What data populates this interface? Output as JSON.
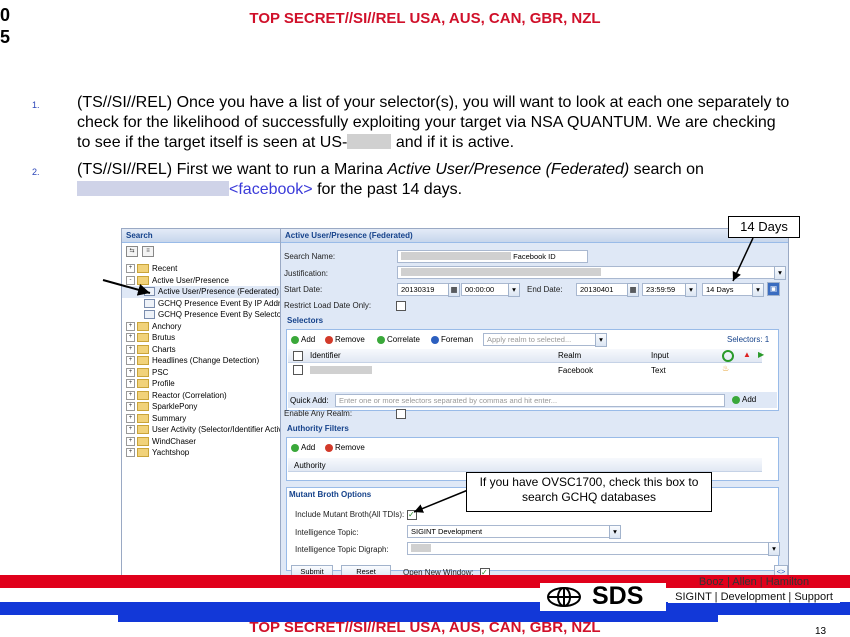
{
  "classification": {
    "top": "TOP SECRET//SI//REL USA, AUS, CAN, GBR, NZL",
    "bottom": "TOP SECRET//SI//REL USA, AUS, CAN, GBR, NZL"
  },
  "cutoff_chars": {
    "a": "0",
    "b": "5"
  },
  "steps": [
    {
      "num": "1.",
      "text": "(TS//SI//REL) Once you have a list of your selector(s), you will want to look at each one separately to check for the likelihood of successfully exploiting your target via NSA QUANTUM. We are checking to see if the target itself is seen at US-",
      "tail": "and if it is active."
    },
    {
      "num": "2.",
      "pre": "(TS//SI//REL) First we want to run a Marina ",
      "italic": "Active User/Presence (Federated)",
      "post": "  search on",
      "fb": "<facebook>",
      "end": " for the past 14 days."
    }
  ],
  "callouts": {
    "days": "14 Days",
    "ovsc": "If you have OVSC1700, check this box to search GCHQ databases"
  },
  "app": {
    "left_title": "Search",
    "tree": [
      {
        "label": "Recent",
        "type": "folder",
        "exp": "+"
      },
      {
        "label": "Active User/Presence",
        "type": "folder",
        "exp": "-"
      },
      {
        "label": "Active User/Presence (Federated)",
        "type": "doc"
      },
      {
        "label": "GCHQ Presence Event By IP Address",
        "type": "doc"
      },
      {
        "label": "GCHQ Presence Event By Selector",
        "type": "doc"
      },
      {
        "label": "Anchory",
        "type": "folder",
        "exp": "+"
      },
      {
        "label": "Brutus",
        "type": "folder",
        "exp": "+"
      },
      {
        "label": "Charts",
        "type": "folder",
        "exp": "+"
      },
      {
        "label": "Headlines (Change Detection)",
        "type": "folder",
        "exp": "+"
      },
      {
        "label": "PSC",
        "type": "folder",
        "exp": "+"
      },
      {
        "label": "Profile",
        "type": "folder",
        "exp": "+"
      },
      {
        "label": "Reactor (Correlation)",
        "type": "folder",
        "exp": "+"
      },
      {
        "label": "SparklePony",
        "type": "folder",
        "exp": "+"
      },
      {
        "label": "Summary",
        "type": "folder",
        "exp": "+"
      },
      {
        "label": "User Activity (Selector/Identifier Activity)",
        "type": "folder",
        "exp": "+"
      },
      {
        "label": "WindChaser",
        "type": "folder",
        "exp": "+"
      },
      {
        "label": "Yachtshop",
        "type": "folder",
        "exp": "+"
      }
    ],
    "form_title": "Active User/Presence (Federated)",
    "search_name_label": "Search Name:",
    "search_name_value": "Facebook ID",
    "justification_label": "Justification:",
    "start_label": "Start Date:",
    "start_date": "20130319",
    "start_time": "00:00:00",
    "end_label": "End Date:",
    "end_date": "20130401",
    "end_time": "23:59:59",
    "range": "14 Days",
    "restrict_label": "Restrict Load Date Only:",
    "selectors_title": "Selectors",
    "sel_add": "Add",
    "sel_remove": "Remove",
    "sel_correlate": "Correlate",
    "sel_foreman": "Foreman",
    "realm_placeholder": "Apply realm to selected...",
    "selectors_count": "Selectors: 1",
    "col_identifier": "Identifier",
    "col_realm": "Realm",
    "col_input": "Input",
    "row_realm": "Facebook",
    "row_input": "Text",
    "quick_add_label": "Quick Add:",
    "quick_add_placeholder": "Enter one or more selectors separated by commas and hit enter...",
    "quick_add_btn": "Add",
    "enable_realm_label": "Enable Any Realm:",
    "authority_title": "Authority Filters",
    "auth_add": "Add",
    "auth_remove": "Remove",
    "auth_col": "Authority",
    "mutant_title": "Mutant Broth Options",
    "mutant_label": "Include Mutant Broth(All TDIs):",
    "intel_label": "Intelligence Topic:",
    "intel_value": "SIGINT Development",
    "digraph_label": "Intelligence Topic Digraph:",
    "submit": "Submit",
    "reset": "Reset",
    "open_new_label": "Open New Window:"
  },
  "footer": {
    "sds": "SDS",
    "company": "Booz | Allen | Hamilton",
    "dept": "SIGINT | Development | Support",
    "page": "13"
  },
  "colors": {
    "classification": "#d0102a",
    "red_bar": "#e0001b",
    "blue_bar": "#1238d8",
    "panel": "#dfe8f6",
    "header_text": "#15428b"
  }
}
